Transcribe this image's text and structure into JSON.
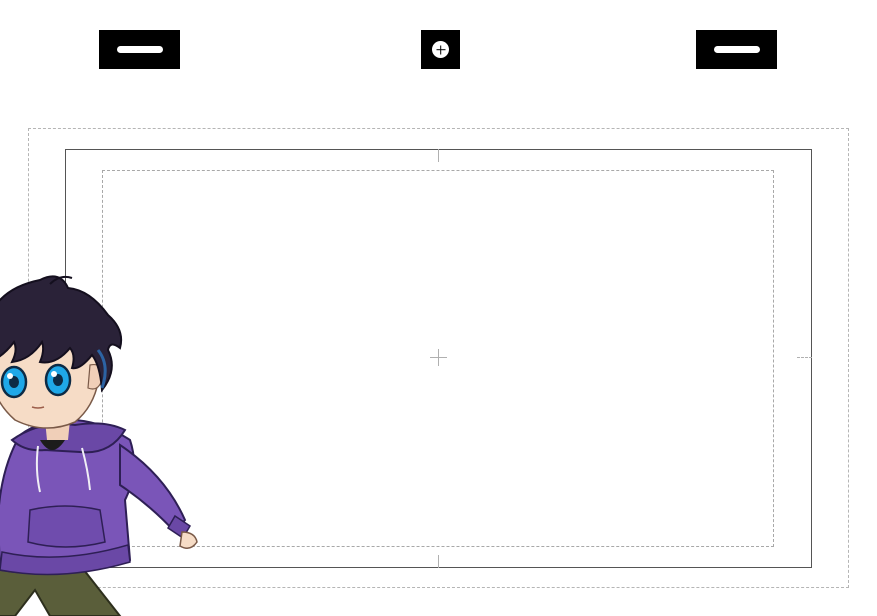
{
  "toolbar": {
    "left_button_icon": "pill-icon",
    "center_button_icon": "plus-circle-icon",
    "right_button_icon": "pill-icon"
  },
  "canvas": {
    "center_mark_icon": "crosshair-icon"
  },
  "mascot": {
    "description_icon": "character-illustration",
    "colors": {
      "hair": "#2a2238",
      "hoodie": "#7a55b8",
      "eyes": "#1fa8e8",
      "skin": "#f6dcc6",
      "pants": "#5a5e3a"
    }
  },
  "colors": {
    "button_bg": "#000000",
    "frame_line": "#555555",
    "guide_line": "#b5b5b5"
  }
}
